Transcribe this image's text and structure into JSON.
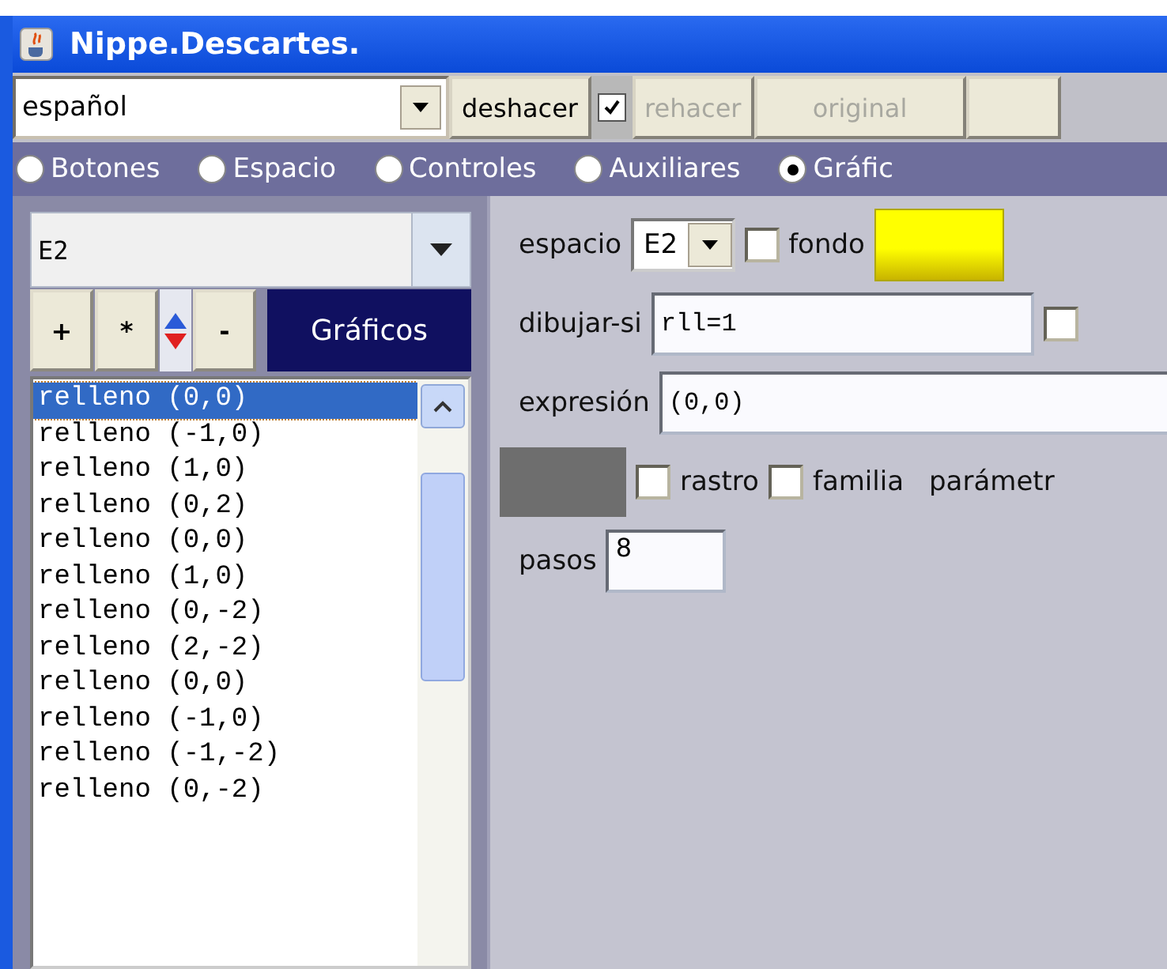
{
  "window": {
    "title": "Nippe.Descartes."
  },
  "toolbar": {
    "language": "español",
    "undo": {
      "label": "deshacer"
    },
    "undo_check": {
      "checked": true
    },
    "redo": {
      "label": "rehacer",
      "disabled": true
    },
    "original": {
      "label": "original",
      "disabled": true
    }
  },
  "tabs": [
    {
      "label": "Botones",
      "selected": false
    },
    {
      "label": "Espacio",
      "selected": false
    },
    {
      "label": "Controles",
      "selected": false
    },
    {
      "label": "Auxiliares",
      "selected": false
    },
    {
      "label": "Gráfic",
      "selected": true
    }
  ],
  "left": {
    "space_select": "E2",
    "buttons": [
      "+",
      "*",
      "-"
    ],
    "heading": "Gráficos",
    "items": [
      {
        "label": "relleno (0,0)",
        "selected": true
      },
      {
        "label": "relleno (-1,0)",
        "selected": false
      },
      {
        "label": "relleno (1,0)",
        "selected": false
      },
      {
        "label": "relleno (0,2)",
        "selected": false
      },
      {
        "label": "relleno (0,0)",
        "selected": false
      },
      {
        "label": "relleno (1,0)",
        "selected": false
      },
      {
        "label": "relleno (0,-2)",
        "selected": false
      },
      {
        "label": "relleno (2,-2)",
        "selected": false
      },
      {
        "label": "relleno (0,0)",
        "selected": false
      },
      {
        "label": "relleno (-1,0)",
        "selected": false
      },
      {
        "label": "relleno (-1,-2)",
        "selected": false
      },
      {
        "label": "relleno (0,-2)",
        "selected": false
      }
    ]
  },
  "editor": {
    "espacio": {
      "label": "espacio",
      "value": "E2"
    },
    "fondo": {
      "label": "fondo",
      "checked": false,
      "color": "#ffff00"
    },
    "dibujar_si": {
      "label": "dibujar-si",
      "value": "rll=1",
      "checked": false
    },
    "expresion": {
      "label": "expresión",
      "value": "(0,0)"
    },
    "trace": {
      "color": "#6e6e6e"
    },
    "rastro": {
      "label": "rastro",
      "checked": false
    },
    "familia": {
      "label": "familia",
      "checked": false
    },
    "parametro": "parámetr",
    "pasos": {
      "label": "pasos",
      "value": "8"
    }
  }
}
